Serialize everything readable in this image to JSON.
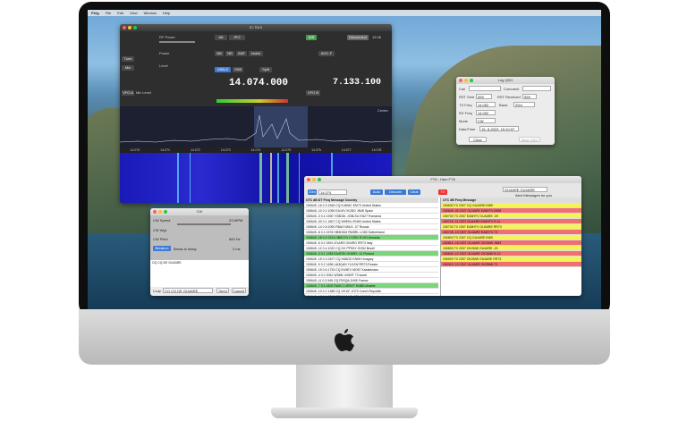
{
  "menubar": {
    "items": [
      "Flrig",
      "File",
      "Edit",
      "View",
      "Window",
      "Help"
    ]
  },
  "radio": {
    "title": "IC-7610",
    "rf_power_label": "RF Power",
    "power_label": "Power",
    "mic_label": "Mic",
    "level_label": "Level",
    "mic_level_label": "Mic Level",
    "tune": "Tune",
    "att": "Att",
    "split": "Split",
    "a_b": "A/B",
    "mode_usb": "USB-D",
    "mode_ssb": "SSB",
    "freq_a": "14.074.000",
    "freq_b": "7.133.100",
    "vfo": "VFO A",
    "vfo_b": "VFO B",
    "nb": "NB",
    "nr": "NR",
    "anf": "ANF",
    "agc": "AGC-F",
    "ipo": "IPO",
    "notch": "Notch",
    "disconnect": "Disconnect",
    "time": "15:48",
    "spectrum_ticks": [
      "14.070",
      "14.071",
      "14.072",
      "14.073",
      "14.074",
      "14.075",
      "14.076",
      "14.077",
      "14.078"
    ],
    "center": "Center"
  },
  "log_qso": {
    "title": "Log QSO",
    "call_label": "Call",
    "comment_label": "Comment",
    "rst_sent_label": "RST Sent",
    "rst_sent": "599",
    "rst_recv_label": "RST Received",
    "rst_recv": "599",
    "tx_freq_label": "TX Freq",
    "tx_freq": "14.052",
    "rx_freq_label": "RX Freq",
    "rx_freq": "14.052",
    "band_label": "Band",
    "band": "20m",
    "mode_label": "Mode",
    "mode": "CW",
    "date_label": "Date/Time",
    "date": "15- 8-2023, 15:10:07",
    "clear": "Clear",
    "save": "Save QSO"
  },
  "cw": {
    "title": "CW",
    "speed_label": "CW Speed",
    "speed": "23 WPM",
    "weight_label": "CW Wgt",
    "pitch_label": "CW Pitch",
    "pitch": "800 Hz",
    "break_in": "Break-in",
    "delay_label": "Break-in delay",
    "delay": "2 ms",
    "text": "CQ CQ DE GU4ARE",
    "send": "Send",
    "cancel": "Cancel",
    "loop_label": "Loop"
  },
  "ft8": {
    "title": "FT8 - Ham FT8",
    "band": "20m",
    "freq": "14.074",
    "decode": "Decode",
    "auto": "Auto",
    "clear": "Clear",
    "headers": [
      "UTC",
      "dB",
      "DT",
      "Freq",
      "Message",
      "Country"
    ],
    "rows": [
      [
        "150645",
        "-16",
        "0.3",
        "1545",
        "CQ K4HMC EM73",
        "United States"
      ],
      [
        "150645",
        "-10",
        "0.2",
        "1050",
        "EA1KV IK2DD JN45",
        "Spain"
      ],
      [
        "150645",
        "-3",
        "0.4",
        "1390",
        "YO8DDL JO8LSU KN27",
        "Romania"
      ],
      [
        "150645",
        "-20",
        "0.1",
        "1607",
        "CQ W9EKU EN50",
        "United States"
      ],
      [
        "150645",
        "-14",
        "0.5",
        "2090",
        "R8AS N5UX -07",
        "Russia"
      ],
      [
        "150645",
        "-8",
        "0.3",
        "1576",
        "HB9DDM RW8RL LO80",
        "Switzerland"
      ],
      [
        "150645",
        "-18",
        "0.2",
        "2214",
        "HB9CYV LY2BV R-09",
        "Lithuania"
      ],
      [
        "150645",
        "-6",
        "0.2",
        "1891",
        "IZ1ARS ON4RG RR73",
        "Italy"
      ],
      [
        "150645",
        "-12",
        "0.4",
        "1022",
        "CQ DX PP5XX GG52",
        "Brazil"
      ],
      [
        "150645",
        "-2",
        "0.1",
        "1283",
        "EA4FZK OH6RX -11",
        "Finland"
      ],
      [
        "150645",
        "-15",
        "0.3",
        "2427",
        "CQ HA8GD KN06",
        "Hungary"
      ],
      [
        "150645",
        "-9",
        "0.2",
        "1456",
        "UA3QAN YU1JW RR73",
        "Russia"
      ],
      [
        "150645",
        "-19",
        "0.6",
        "1733",
        "CQ EU9EX MO67",
        "Kazakhstan"
      ],
      [
        "150645",
        "-4",
        "0.2",
        "2061",
        "W3MK 4X5HF 73",
        "Israel"
      ],
      [
        "150645",
        "-11",
        "0.3",
        "945",
        "CQ F5SQA JN05",
        "France"
      ],
      [
        "150645",
        "-7",
        "0.4",
        "1602",
        "RA9CJ UR5VT KN88",
        "Ukraine"
      ],
      [
        "150645",
        "-13",
        "0.2",
        "1188",
        "CQ OK1IF JO70",
        "Czech Republic"
      ],
      [
        "150645",
        "-17",
        "0.1",
        "2312",
        "SP9AWY DL6ZB JO62",
        "Poland"
      ],
      [
        "150645",
        "-5",
        "0.3",
        "1770",
        "CQ I2SSB JN45",
        "Italy"
      ],
      [
        "150645",
        "-21",
        "0.5",
        "1311",
        "GU4ARE PE1OZM -03",
        "Netherlands"
      ]
    ],
    "right_header": "GU4ARE GU4ARE",
    "tx_label": "TX",
    "right_rows": [
      [
        "150630",
        "TX",
        "2307",
        "CQ GU4ARE IN89"
      ],
      [
        "150645",
        "-09",
        "2307",
        "GU4ARE EA5HTV IM98"
      ],
      [
        "150700",
        "TX",
        "2307",
        "EA5HTV GU4ARE -09"
      ],
      [
        "150715",
        "-11",
        "2307",
        "GU4ARE EA5HTV R-11"
      ],
      [
        "150730",
        "TX",
        "2307",
        "EA5HTV GU4ARE RR73"
      ],
      [
        "150745",
        "-13",
        "2307",
        "GU4ARE EA5HTV 73"
      ],
      [
        "150800",
        "TX",
        "2307",
        "CQ GU4ARE IN89"
      ],
      [
        "150815",
        "-15",
        "2307",
        "GU4ARE OK2MW JN89"
      ],
      [
        "150830",
        "TX",
        "2307",
        "OK2MW GU4ARE -15"
      ],
      [
        "150845",
        "-12",
        "2307",
        "GU4ARE OK2MW R-12"
      ],
      [
        "150900",
        "TX",
        "2307",
        "OK2MW GU4ARE RR73"
      ],
      [
        "150915",
        "-10",
        "2307",
        "GU4ARE OK2MW 73"
      ]
    ],
    "check": "Alert Messages for you",
    "colors": {
      "green": "#7bd67b",
      "red": "#f07070",
      "yellow": "#f5f25a",
      "cq": "#ffffff"
    }
  }
}
